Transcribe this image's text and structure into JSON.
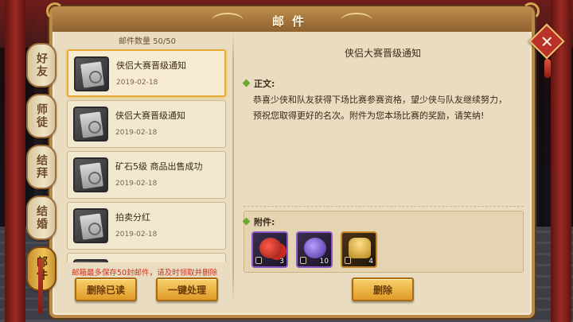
{
  "window": {
    "title": "邮件"
  },
  "tabs": [
    {
      "label": "好友",
      "active": false
    },
    {
      "label": "师徒",
      "active": false
    },
    {
      "label": "结拜",
      "active": false
    },
    {
      "label": "结婚",
      "active": false
    },
    {
      "label": "邮件",
      "active": true
    }
  ],
  "mail_list": {
    "count_label": "邮件数量 50/50",
    "items": [
      {
        "subject": "侠侣大赛晋级通知",
        "date": "2019-02-18",
        "selected": true
      },
      {
        "subject": "侠侣大赛晋级通知",
        "date": "2019-02-18",
        "selected": false
      },
      {
        "subject": "矿石5级 商品出售成功",
        "date": "2019-02-18",
        "selected": false
      },
      {
        "subject": "拍卖分红",
        "date": "2019-02-18",
        "selected": false
      },
      {
        "subject": "",
        "date": "",
        "selected": false
      }
    ],
    "storage_warning": "邮箱最多保存50封邮件，请及时领取并删除"
  },
  "buttons": {
    "delete_read": "删除已读",
    "one_click": "一键处理",
    "delete": "删除"
  },
  "detail": {
    "title": "侠侣大赛晋级通知",
    "body_label": "正文:",
    "body_text": "恭喜少侠和队友获得下场比赛参赛资格，望少侠与队友继续努力，预祝您取得更好的名次。附件为您本场比赛的奖励，请笑纳!",
    "attachments_label": "附件:",
    "attachments": [
      {
        "icon": "fruit-item-icon",
        "count": "3",
        "rarity_color": "#8a58c8"
      },
      {
        "icon": "gem-item-icon",
        "count": "10",
        "rarity_color": "#8a58c8"
      },
      {
        "icon": "gold-ingot-icon",
        "count": "4",
        "rarity_color": "#c9882a"
      }
    ]
  },
  "colors": {
    "warning": "#d03020",
    "accent_gold": "#e09a26",
    "selected_border": "#e8a832"
  }
}
